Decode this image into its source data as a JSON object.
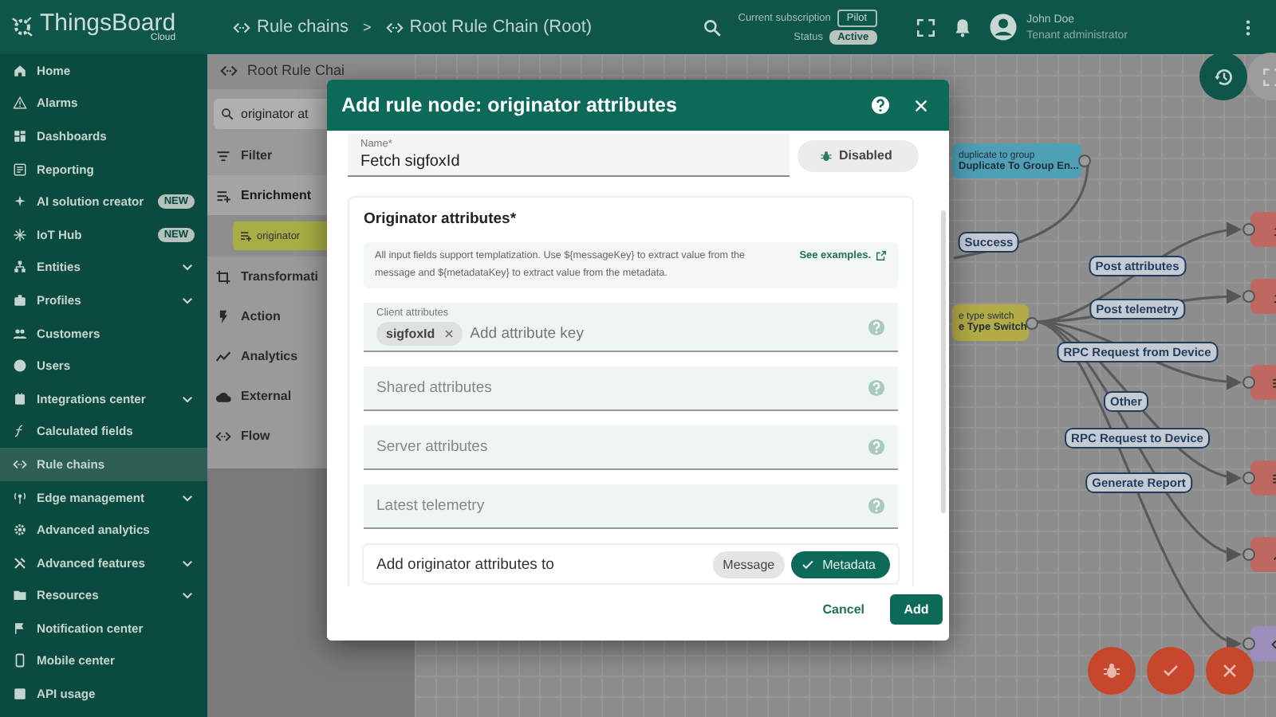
{
  "header": {
    "logo": "ThingsBoard",
    "logo_sub": "Cloud",
    "breadcrumbs": [
      {
        "label": "Rule chains"
      },
      {
        "label": "Root Rule Chain (Root)"
      }
    ],
    "separator": ">",
    "subscription_label": "Current subscription",
    "subscription": "Pilot",
    "status_label": "Status",
    "status": "Active",
    "user_name": "John Doe",
    "user_role": "Tenant administrator"
  },
  "sidebar": {
    "items": [
      {
        "label": "Home",
        "submenu": false,
        "selected": false
      },
      {
        "label": "Alarms",
        "submenu": false,
        "selected": false
      },
      {
        "label": "Dashboards",
        "submenu": false,
        "selected": false
      },
      {
        "label": "Reporting",
        "submenu": false,
        "selected": false
      },
      {
        "label": "AI solution creator",
        "badge": "NEW",
        "submenu": false,
        "selected": false
      },
      {
        "label": "IoT Hub",
        "badge": "NEW",
        "submenu": false,
        "selected": false
      },
      {
        "label": "Entities",
        "submenu": true,
        "selected": false
      },
      {
        "label": "Profiles",
        "submenu": true,
        "selected": false
      },
      {
        "label": "Customers",
        "submenu": false,
        "selected": false
      },
      {
        "label": "Users",
        "submenu": false,
        "selected": false
      },
      {
        "label": "Integrations center",
        "submenu": true,
        "selected": false
      },
      {
        "label": "Calculated fields",
        "submenu": false,
        "selected": false
      },
      {
        "label": "Rule chains",
        "submenu": false,
        "selected": true
      },
      {
        "label": "Edge management",
        "submenu": true,
        "selected": false
      },
      {
        "label": "Advanced analytics",
        "submenu": false,
        "selected": false
      },
      {
        "label": "Advanced features",
        "submenu": true,
        "selected": false
      },
      {
        "label": "Resources",
        "submenu": true,
        "selected": false
      },
      {
        "label": "Notification center",
        "submenu": false,
        "selected": false
      },
      {
        "label": "Mobile center",
        "submenu": false,
        "selected": false
      },
      {
        "label": "API usage",
        "submenu": false,
        "selected": false
      }
    ]
  },
  "library": {
    "title": "Root Rule Chai",
    "search": "originator at",
    "categories": [
      {
        "label": "Filter",
        "expanded": false
      },
      {
        "label": "Enrichment",
        "expanded": true,
        "nodes": [
          {
            "label": "originator"
          }
        ]
      },
      {
        "label": "Transformati",
        "expanded": false
      },
      {
        "label": "Action",
        "expanded": false
      },
      {
        "label": "Analytics",
        "expanded": false
      },
      {
        "label": "External",
        "expanded": false
      },
      {
        "label": "Flow",
        "expanded": false
      }
    ]
  },
  "canvas": {
    "nodes": [
      {
        "kind": "labeled",
        "type_label": "duplicate to group",
        "name": "Duplicate To Group En...",
        "color": "#4f9fb6"
      },
      {
        "kind": "labeled",
        "type_label": "e type switch",
        "name": "e Type Switch",
        "color": "#b3ab45"
      },
      {
        "kind": "icon",
        "color": "#bf6862"
      },
      {
        "kind": "icon",
        "color": "#bf6862"
      },
      {
        "kind": "icon",
        "color": "#bf6862"
      },
      {
        "kind": "icon",
        "color": "#bf6862"
      },
      {
        "kind": "icon",
        "color": "#bf6862"
      },
      {
        "kind": "icon",
        "color": "#9c8fbd"
      }
    ],
    "links": [
      {
        "label": "Success"
      },
      {
        "label": "Post attributes"
      },
      {
        "label": "Post telemetry"
      },
      {
        "label": "RPC Request from Device"
      },
      {
        "label": "Other"
      },
      {
        "label": "RPC Request to Device"
      },
      {
        "label": "Generate Report"
      }
    ]
  },
  "dialog": {
    "title": "Add rule node: originator attributes",
    "name_field": {
      "label": "Name*",
      "value": "Fetch sigfoxId"
    },
    "debug_button": {
      "label": "Disabled"
    },
    "section_title": "Originator attributes*",
    "info": {
      "text": "All input fields support templatization. Use ${messageKey} to extract value from the message and ${metadataKey} to extract value from the metadata.",
      "link": "See examples."
    },
    "fields": [
      {
        "label": "Client attributes",
        "chips": [
          "sigfoxId"
        ],
        "placeholder": "Add attribute key"
      },
      {
        "placeholder": "Shared attributes"
      },
      {
        "placeholder": "Server attributes"
      },
      {
        "placeholder": "Latest telemetry"
      }
    ],
    "target": {
      "label": "Add originator attributes to",
      "options": [
        {
          "label": "Message",
          "selected": false
        },
        {
          "label": "Metadata",
          "selected": true
        }
      ]
    },
    "buttons": [
      {
        "label": "Cancel",
        "kind": "text"
      },
      {
        "label": "Add",
        "kind": "primary"
      }
    ]
  }
}
